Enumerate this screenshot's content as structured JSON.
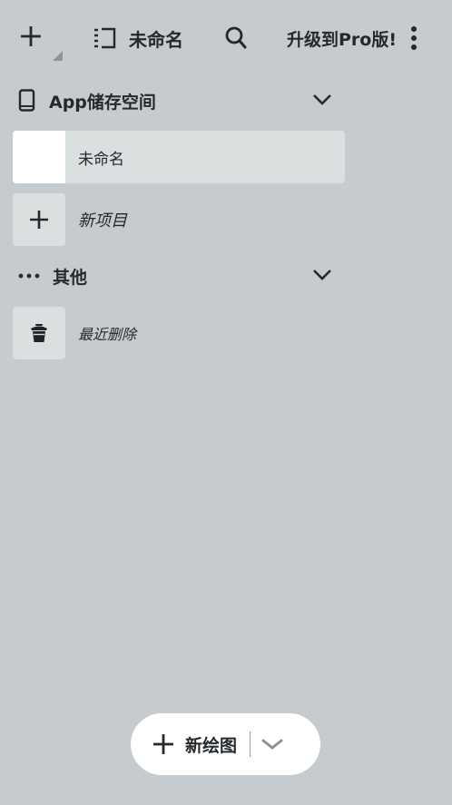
{
  "toolbar": {
    "add_icon": "plus-icon",
    "document_icon": "sidebar-panel-icon",
    "document_title": "未命名",
    "search_icon": "search-icon",
    "upgrade_label": "升级到Pro版!",
    "more_icon": "more-vertical-icon"
  },
  "sections": {
    "storage": {
      "icon": "phone-icon",
      "title": "App储存空间",
      "chevron": "chevron-down-icon",
      "items": [
        {
          "label": "未命名",
          "selected": true
        },
        {
          "label": "新项目",
          "icon": "plus-icon"
        }
      ]
    },
    "other": {
      "icon": "more-horizontal-icon",
      "title": "其他",
      "chevron": "chevron-down-icon",
      "items": [
        {
          "label": "最近删除",
          "icon": "trash-icon"
        }
      ]
    }
  },
  "bottom_bar": {
    "new_drawing_label": "新绘图",
    "plus_icon": "plus-icon",
    "dropdown_icon": "chevron-down-icon"
  },
  "colors": {
    "background": "#c6cbcf",
    "selected_row": "#dadfe0",
    "pill": "#ffffff",
    "text": "#25292c"
  }
}
